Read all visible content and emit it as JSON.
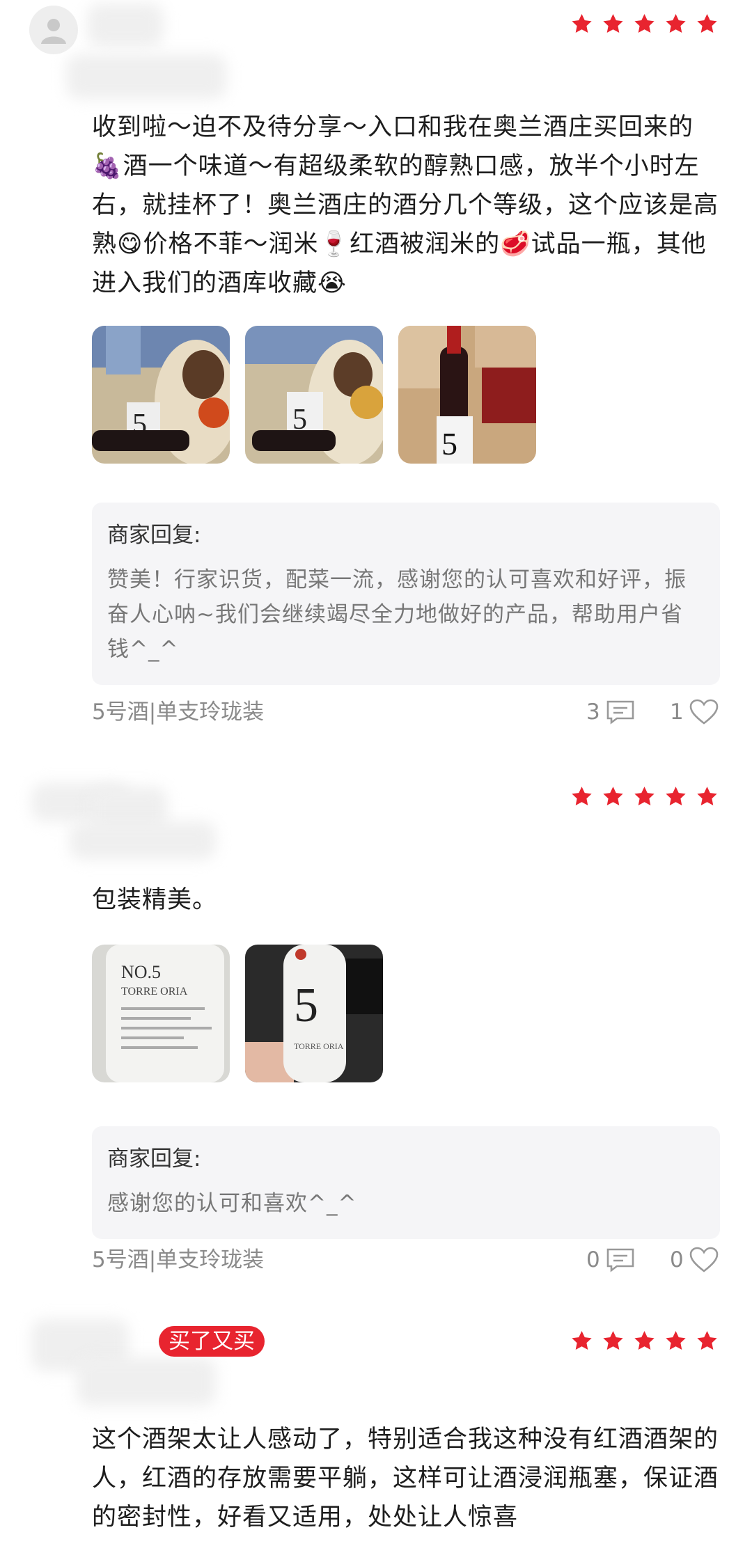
{
  "reviews": [
    {
      "stars": 5,
      "content": "收到啦～迫不及待分享～入口和我在奥兰酒庄买回来的🍇酒一个味道～有超级柔软的醇熟口感，放半个小时左右，就挂杯了！奥兰酒庄的酒分几个等级，这个应该是高熟😋价格不菲～润米🍷红酒被润米的🥩试品一瓶，其他进入我们的酒库收藏😭",
      "photos": [
        "wine-dinner-photo",
        "wine-dinner-photo-2",
        "wine-boxes-photo"
      ],
      "reply_title": "商家回复:",
      "reply_text": "赞美！行家识货，配菜一流，感谢您的认可喜欢和好评，振奋人心呐~我们会继续竭尽全力地做好的产品，帮助用户省钱^_^",
      "variant": "5号酒|单支玲珑装",
      "comment_count": "3",
      "like_count": "1"
    },
    {
      "stars": 5,
      "content": "包装精美。",
      "photos": [
        "bottle-label-photo",
        "bottle-keyboard-photo"
      ],
      "reply_title": "商家回复:",
      "reply_text": "感谢您的认可和喜欢^_^",
      "variant": "5号酒|单支玲珑装",
      "comment_count": "0",
      "like_count": "0"
    },
    {
      "stars": 5,
      "badge": "买了又买",
      "content": "这个酒架太让人感动了，特别适合我这种没有红酒酒架的人，红酒的存放需要平躺，这样可让酒浸润瓶塞，保证酒的密封性，好看又适用，处处让人惊喜"
    }
  ],
  "colors": {
    "accent": "#e8242f",
    "reply_bg": "#f5f5f7",
    "muted": "#8a8a8a"
  }
}
